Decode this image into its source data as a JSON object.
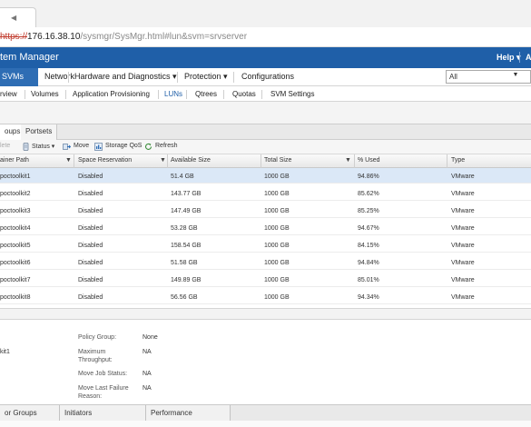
{
  "browser": {
    "url_protocol": "https://",
    "url_host": "176.16.38.10",
    "url_path": "/sysmgr/SysMgr.html#lun&svm=srvserver"
  },
  "app": {
    "title": "tem Manager",
    "help_label": "Help",
    "help_caret": "▾",
    "partial_right": "A"
  },
  "mainnav": {
    "active": "SVMs",
    "items": [
      "Network",
      "Hardware and Diagnostics ▾",
      "Protection ▾",
      "Configurations"
    ],
    "filter_value": "All"
  },
  "subnav": {
    "items": [
      "rview",
      "Volumes",
      "Application Provisioning",
      "LUNs",
      "Qtrees",
      "Quotas",
      "SVM Settings"
    ],
    "selected": "LUNs"
  },
  "tabs": [
    "oups",
    "Portsets"
  ],
  "toolbar": {
    "delete": "lete",
    "status": "Status ▾",
    "move": "Move",
    "storage_qos": "Storage QoS",
    "refresh": "Refresh"
  },
  "grid": {
    "columns": [
      "ainer Path",
      "Space Reservation",
      "Available Size",
      "Total Size",
      "% Used",
      "Type"
    ],
    "rows": [
      {
        "path": "poctoolkit1",
        "reservation": "Disabled",
        "available": "51.4 GB",
        "total": "1000 GB",
        "used": "94.86%",
        "type": "VMware"
      },
      {
        "path": "poctoolkit2",
        "reservation": "Disabled",
        "available": "143.77 GB",
        "total": "1000 GB",
        "used": "85.62%",
        "type": "VMware"
      },
      {
        "path": "poctoolkit3",
        "reservation": "Disabled",
        "available": "147.49 GB",
        "total": "1000 GB",
        "used": "85.25%",
        "type": "VMware"
      },
      {
        "path": "poctoolkit4",
        "reservation": "Disabled",
        "available": "53.28 GB",
        "total": "1000 GB",
        "used": "94.67%",
        "type": "VMware"
      },
      {
        "path": "poctoolkit5",
        "reservation": "Disabled",
        "available": "158.54 GB",
        "total": "1000 GB",
        "used": "84.15%",
        "type": "VMware"
      },
      {
        "path": "poctoolkit6",
        "reservation": "Disabled",
        "available": "51.58 GB",
        "total": "1000 GB",
        "used": "94.84%",
        "type": "VMware"
      },
      {
        "path": "poctoolkit7",
        "reservation": "Disabled",
        "available": "149.89 GB",
        "total": "1000 GB",
        "used": "85.01%",
        "type": "VMware"
      },
      {
        "path": "poctoolkit8",
        "reservation": "Disabled",
        "available": "56.56 GB",
        "total": "1000 GB",
        "used": "94.34%",
        "type": "VMware"
      }
    ]
  },
  "details": {
    "left_value": "kit1",
    "policy_group_label": "Policy Group:",
    "policy_group_value": "None",
    "max_throughput_label1": "Maximum",
    "max_throughput_label2": "Throughput:",
    "max_throughput_value": "NA",
    "move_job_label": "Move Job Status:",
    "move_job_value": "NA",
    "move_fail_label1": "Move Last Failure",
    "move_fail_label2": "Reason:",
    "move_fail_value": "NA"
  },
  "bottom_tabs": [
    "or Groups",
    "Initiators",
    "Performance"
  ],
  "colors": {
    "title_bar": "#1f5fa8",
    "nav_active": "#2e6db4",
    "row_selected": "#dbe8f7"
  }
}
